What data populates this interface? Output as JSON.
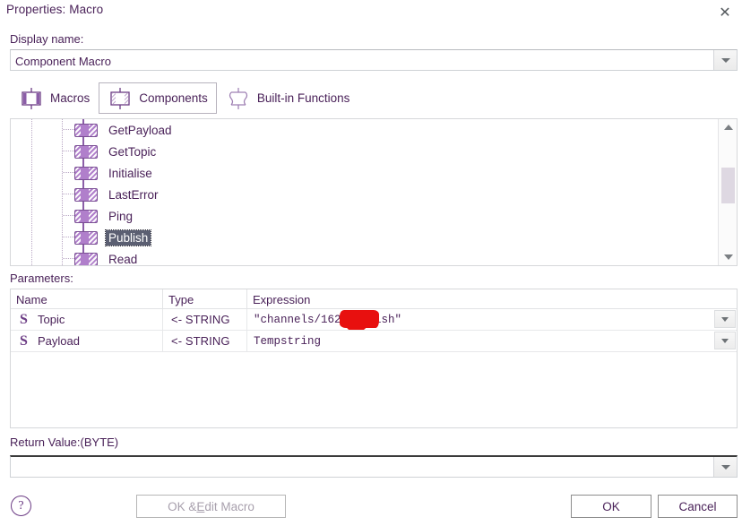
{
  "window": {
    "title": "Properties: Macro",
    "close_icon": "close-icon"
  },
  "display_name": {
    "label": "Display name:",
    "value": "Component Macro",
    "placeholder": "",
    "dropdown_icon": "chevron-down-icon"
  },
  "tabs": [
    {
      "label": "Macros",
      "icon": "component-macro-icon",
      "selected": false
    },
    {
      "label": "Components",
      "icon": "component-hatched-icon",
      "selected": true
    },
    {
      "label": "Built-in Functions",
      "icon": "function-squiggle-icon",
      "selected": false
    }
  ],
  "tree": {
    "items": [
      {
        "label": "GetPayload",
        "selected": false
      },
      {
        "label": "GetTopic",
        "selected": false
      },
      {
        "label": "Initialise",
        "selected": false
      },
      {
        "label": "LastError",
        "selected": false
      },
      {
        "label": "Ping",
        "selected": false
      },
      {
        "label": "Publish",
        "selected": true
      },
      {
        "label": "Read",
        "selected": false
      }
    ],
    "scrollbar": {
      "up_icon": "scroll-up-arrow-icon",
      "down_icon": "scroll-down-arrow-icon"
    }
  },
  "parameters": {
    "label": "Parameters:",
    "columns": [
      "Name",
      "Type",
      "Expression"
    ],
    "rows": [
      {
        "sigil": "S",
        "name": "Topic",
        "type": "<- STRING",
        "expression_before": "\"channels/16",
        "expression_after": "2/publish\"",
        "redacted": true,
        "dropdown_icon": "chevron-down-icon"
      },
      {
        "sigil": "S",
        "name": "Payload",
        "type": "<- STRING",
        "expression_before": "Tempstring",
        "expression_after": "",
        "redacted": false,
        "dropdown_icon": "chevron-down-icon"
      }
    ]
  },
  "return_value": {
    "label": "Return Value:(BYTE)",
    "value": "",
    "placeholder": "",
    "dropdown_icon": "chevron-down-icon"
  },
  "footer": {
    "help_label": "?",
    "edit_macro_label_pre": "OK & ",
    "edit_macro_label_key": "E",
    "edit_macro_label_post": "dit Macro",
    "ok_label": "OK",
    "cancel_label": "Cancel"
  },
  "colors": {
    "text_purple": "#4a2259",
    "icon_purple": "#b07fcb",
    "selection_bg": "#5b5f72",
    "redaction_red": "#e8100f"
  }
}
